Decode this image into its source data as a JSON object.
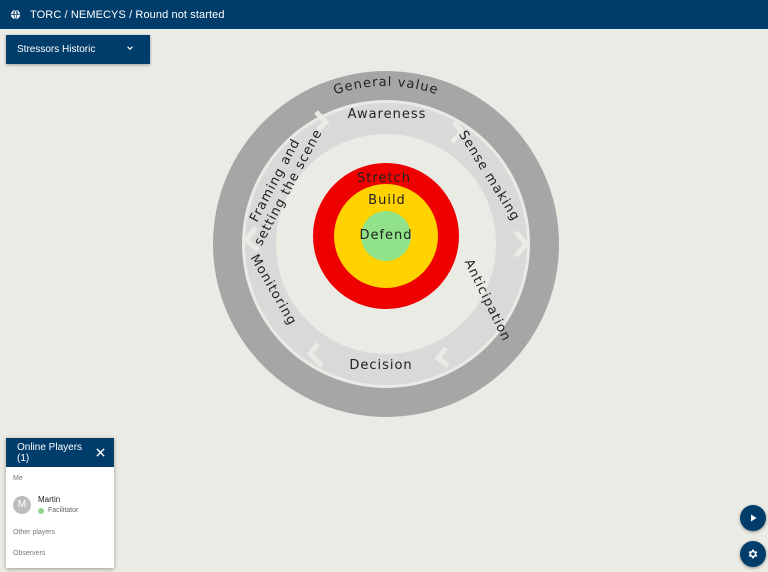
{
  "topbar": {
    "title": "TORC / NEMECYS / Round not started",
    "icon": "globe-icon"
  },
  "stressors": {
    "label": "Stressors Historic",
    "icon": "chevron-down-icon"
  },
  "diagram": {
    "outer_ring": {
      "label": "General value",
      "color": "#a6a6a6"
    },
    "segments": [
      {
        "label": "Awareness",
        "color": "#d9d9d9"
      },
      {
        "label": "Sense making",
        "color": "#d9d9d9"
      },
      {
        "label": "Anticipation",
        "color": "#d9d9d9"
      },
      {
        "label": "Decision",
        "color": "#d9d9d9"
      },
      {
        "label": "Monitoring",
        "color": "#d9d9d9"
      },
      {
        "label": "Framing and",
        "label_line2": "setting the scene",
        "color": "#d9d9d9"
      }
    ],
    "zones": [
      {
        "label": "Stretch",
        "color": "#ef0000"
      },
      {
        "label": "Build",
        "color": "#ffd200"
      },
      {
        "label": "Defend",
        "color": "#90e388"
      }
    ]
  },
  "players_panel": {
    "title": "Online Players (1)",
    "me_label": "Me",
    "players": [
      {
        "initial": "M",
        "name": "Martin",
        "role": "Facilitator",
        "status_color": "#8bd68b"
      }
    ],
    "other_players_label": "Other players",
    "observers_label": "Observers"
  },
  "fabs": {
    "play_icon": "play-icon",
    "settings_icon": "gear-icon"
  },
  "colors": {
    "primary": "#003d6b",
    "background": "#ebebe6"
  }
}
